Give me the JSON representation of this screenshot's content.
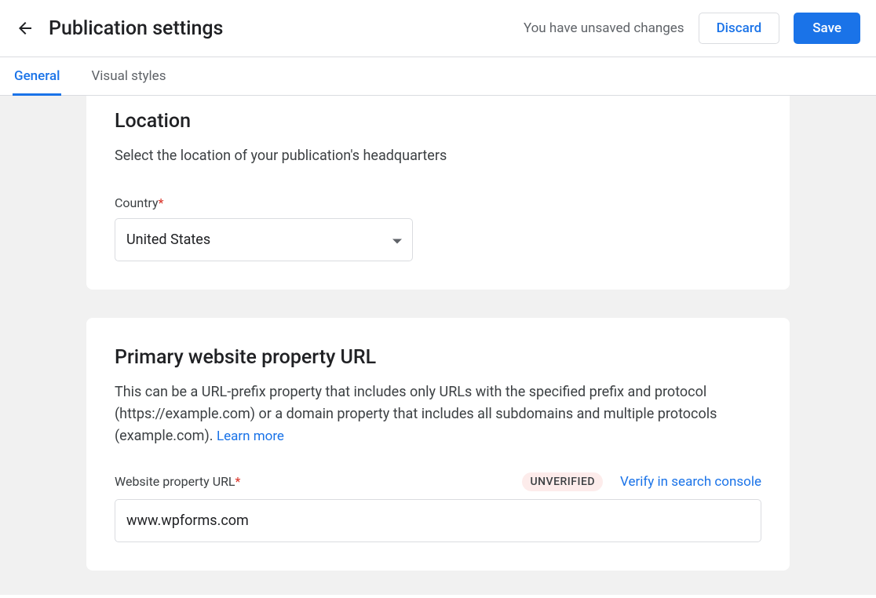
{
  "header": {
    "title": "Publication settings",
    "unsaved_message": "You have unsaved changes",
    "discard_label": "Discard",
    "save_label": "Save"
  },
  "tabs": {
    "general": "General",
    "visual_styles": "Visual styles"
  },
  "location_card": {
    "title": "Location",
    "description": "Select the location of your publication's headquarters",
    "country_label": "Country",
    "country_value": "United States"
  },
  "url_card": {
    "title": "Primary website property URL",
    "description": "This can be a URL-prefix property that includes only URLs with the specified prefix and protocol (https://example.com) or a domain property that includes all subdomains and multiple protocols (example.com). ",
    "learn_more": "Learn more",
    "field_label": "Website property URL",
    "badge": "UNVERIFIED",
    "verify_link": "Verify in search console",
    "value": "www.wpforms.com"
  }
}
